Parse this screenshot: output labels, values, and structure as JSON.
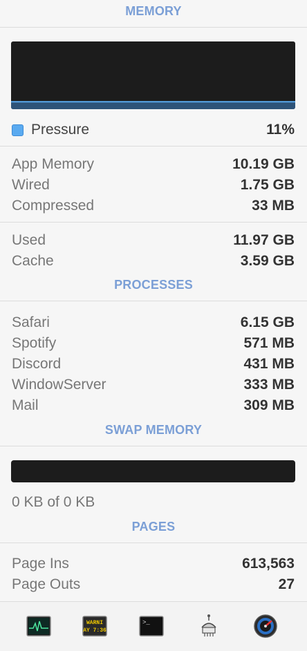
{
  "memory": {
    "header": "MEMORY",
    "graph_level": 0.11,
    "pressure_label": "Pressure",
    "pressure_value": "11%",
    "rows_a": [
      {
        "label": "App Memory",
        "value": "10.19 GB"
      },
      {
        "label": "Wired",
        "value": "1.75 GB"
      },
      {
        "label": "Compressed",
        "value": "33 MB"
      }
    ],
    "rows_b": [
      {
        "label": "Used",
        "value": "11.97 GB"
      },
      {
        "label": "Cache",
        "value": "3.59 GB"
      }
    ]
  },
  "processes": {
    "header": "PROCESSES",
    "items": [
      {
        "label": "Safari",
        "value": "6.15 GB"
      },
      {
        "label": "Spotify",
        "value": "571 MB"
      },
      {
        "label": "Discord",
        "value": "431 MB"
      },
      {
        "label": "WindowServer",
        "value": "333 MB"
      },
      {
        "label": "Mail",
        "value": "309 MB"
      }
    ]
  },
  "swap": {
    "header": "SWAP MEMORY",
    "used_fraction": 0,
    "usage_text": "0 KB of 0 KB"
  },
  "pages": {
    "header": "PAGES",
    "rows": [
      {
        "label": "Page Ins",
        "value": "613,563"
      },
      {
        "label": "Page Outs",
        "value": "27"
      }
    ]
  },
  "toolbar": {
    "icons": [
      {
        "name": "activity-monitor-icon"
      },
      {
        "name": "console-icon",
        "text_line1": "WARNI",
        "text_line2": "AY 7:36"
      },
      {
        "name": "terminal-icon",
        "prompt": ">_"
      },
      {
        "name": "system-information-icon"
      },
      {
        "name": "disk-utility-icon"
      }
    ]
  },
  "colors": {
    "accent_header": "#7b9fd6",
    "graph_line": "#5aaaf0",
    "graph_bg": "#1c1c1c"
  }
}
